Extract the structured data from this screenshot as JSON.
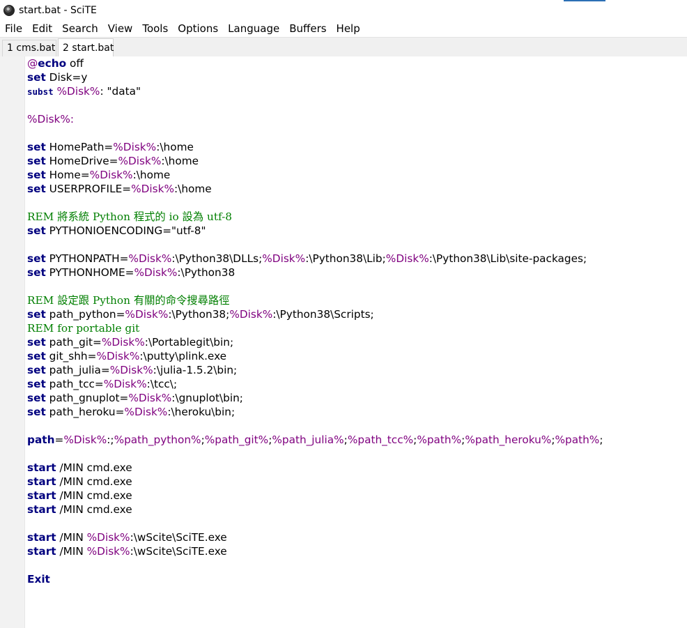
{
  "window": {
    "title": "start.bat - SciTE",
    "icon": "scite-app-icon"
  },
  "menu": [
    "File",
    "Edit",
    "Search",
    "View",
    "Tools",
    "Options",
    "Language",
    "Buffers",
    "Help"
  ],
  "tabs": [
    {
      "label": "1 cms.bat",
      "active": false
    },
    {
      "label": "2 start.bat",
      "active": true
    }
  ],
  "colors": {
    "keyword": "#00007f",
    "variable": "#7f007f",
    "comment": "#007f00",
    "text": "#000000"
  },
  "code": [
    [
      {
        "t": "@",
        "c": "var"
      },
      {
        "t": "echo",
        "c": "kw"
      },
      {
        "t": " off",
        "c": "op"
      }
    ],
    [
      {
        "t": "set",
        "c": "kw"
      },
      {
        "t": " Disk=y",
        "c": "op"
      }
    ],
    [
      {
        "t": "subst",
        "c": "kw-sub"
      },
      {
        "t": " ",
        "c": "op"
      },
      {
        "t": "%Disk%",
        "c": "var"
      },
      {
        "t": ": \"data\"",
        "c": "op"
      }
    ],
    [],
    [
      {
        "t": "%Disk%:",
        "c": "var"
      }
    ],
    [],
    [
      {
        "t": "set",
        "c": "kw"
      },
      {
        "t": " HomePath=",
        "c": "op"
      },
      {
        "t": "%Disk%",
        "c": "var"
      },
      {
        "t": ":\\home",
        "c": "op"
      }
    ],
    [
      {
        "t": "set",
        "c": "kw"
      },
      {
        "t": " HomeDrive=",
        "c": "op"
      },
      {
        "t": "%Disk%",
        "c": "var"
      },
      {
        "t": ":\\home",
        "c": "op"
      }
    ],
    [
      {
        "t": "set",
        "c": "kw"
      },
      {
        "t": " Home=",
        "c": "op"
      },
      {
        "t": "%Disk%",
        "c": "var"
      },
      {
        "t": ":\\home",
        "c": "op"
      }
    ],
    [
      {
        "t": "set",
        "c": "kw"
      },
      {
        "t": " USERPROFILE=",
        "c": "op"
      },
      {
        "t": "%Disk%",
        "c": "var"
      },
      {
        "t": ":\\home",
        "c": "op"
      }
    ],
    [],
    [
      {
        "t": "REM 將系統 Python 程式的 io 設為 utf-8",
        "c": "rem"
      }
    ],
    [
      {
        "t": "set",
        "c": "kw"
      },
      {
        "t": " PYTHONIOENCODING=\"utf-8\"",
        "c": "op"
      }
    ],
    [],
    [
      {
        "t": "set",
        "c": "kw"
      },
      {
        "t": " PYTHONPATH=",
        "c": "op"
      },
      {
        "t": "%Disk%",
        "c": "var"
      },
      {
        "t": ":\\Python38\\DLLs;",
        "c": "op"
      },
      {
        "t": "%Disk%",
        "c": "var"
      },
      {
        "t": ":\\Python38\\Lib;",
        "c": "op"
      },
      {
        "t": "%Disk%",
        "c": "var"
      },
      {
        "t": ":\\Python38\\Lib\\site-packages;",
        "c": "op"
      }
    ],
    [
      {
        "t": "set",
        "c": "kw"
      },
      {
        "t": " PYTHONHOME=",
        "c": "op"
      },
      {
        "t": "%Disk%",
        "c": "var"
      },
      {
        "t": ":\\Python38",
        "c": "op"
      }
    ],
    [],
    [
      {
        "t": "REM 設定跟 Python 有關的命令搜尋路徑",
        "c": "rem"
      }
    ],
    [
      {
        "t": "set",
        "c": "kw"
      },
      {
        "t": " path_python=",
        "c": "op"
      },
      {
        "t": "%Disk%",
        "c": "var"
      },
      {
        "t": ":\\Python38;",
        "c": "op"
      },
      {
        "t": "%Disk%",
        "c": "var"
      },
      {
        "t": ":\\Python38\\Scripts;",
        "c": "op"
      }
    ],
    [
      {
        "t": "REM for portable git",
        "c": "rem"
      }
    ],
    [
      {
        "t": "set",
        "c": "kw"
      },
      {
        "t": " path_git=",
        "c": "op"
      },
      {
        "t": "%Disk%",
        "c": "var"
      },
      {
        "t": ":\\Portablegit\\bin;",
        "c": "op"
      }
    ],
    [
      {
        "t": "set",
        "c": "kw"
      },
      {
        "t": " git_shh=",
        "c": "op"
      },
      {
        "t": "%Disk%",
        "c": "var"
      },
      {
        "t": ":\\putty\\plink.exe",
        "c": "op"
      }
    ],
    [
      {
        "t": "set",
        "c": "kw"
      },
      {
        "t": " path_julia=",
        "c": "op"
      },
      {
        "t": "%Disk%",
        "c": "var"
      },
      {
        "t": ":\\julia-1.5.2\\bin;",
        "c": "op"
      }
    ],
    [
      {
        "t": "set",
        "c": "kw"
      },
      {
        "t": " path_tcc=",
        "c": "op"
      },
      {
        "t": "%Disk%",
        "c": "var"
      },
      {
        "t": ":\\tcc\\;",
        "c": "op"
      }
    ],
    [
      {
        "t": "set",
        "c": "kw"
      },
      {
        "t": " path_gnuplot=",
        "c": "op"
      },
      {
        "t": "%Disk%",
        "c": "var"
      },
      {
        "t": ":\\gnuplot\\bin;",
        "c": "op"
      }
    ],
    [
      {
        "t": "set",
        "c": "kw"
      },
      {
        "t": " path_heroku=",
        "c": "op"
      },
      {
        "t": "%Disk%",
        "c": "var"
      },
      {
        "t": ":\\heroku\\bin;",
        "c": "op"
      }
    ],
    [],
    [
      {
        "t": "path",
        "c": "kw"
      },
      {
        "t": "=",
        "c": "op"
      },
      {
        "t": "%Disk%",
        "c": "var"
      },
      {
        "t": ":;",
        "c": "op"
      },
      {
        "t": "%path_python%",
        "c": "var"
      },
      {
        "t": ";",
        "c": "op"
      },
      {
        "t": "%path_git%",
        "c": "var"
      },
      {
        "t": ";",
        "c": "op"
      },
      {
        "t": "%path_julia%",
        "c": "var"
      },
      {
        "t": ";",
        "c": "op"
      },
      {
        "t": "%path_tcc%",
        "c": "var"
      },
      {
        "t": ";",
        "c": "op"
      },
      {
        "t": "%path%",
        "c": "var"
      },
      {
        "t": ";",
        "c": "op"
      },
      {
        "t": "%path_heroku%",
        "c": "var"
      },
      {
        "t": ";",
        "c": "op"
      },
      {
        "t": "%path%",
        "c": "var"
      },
      {
        "t": ";",
        "c": "op"
      }
    ],
    [],
    [
      {
        "t": "start",
        "c": "kw"
      },
      {
        "t": " /MIN cmd.exe",
        "c": "op"
      }
    ],
    [
      {
        "t": "start",
        "c": "kw"
      },
      {
        "t": " /MIN cmd.exe",
        "c": "op"
      }
    ],
    [
      {
        "t": "start",
        "c": "kw"
      },
      {
        "t": " /MIN cmd.exe",
        "c": "op"
      }
    ],
    [
      {
        "t": "start",
        "c": "kw"
      },
      {
        "t": " /MIN cmd.exe",
        "c": "op"
      }
    ],
    [],
    [
      {
        "t": "start",
        "c": "kw"
      },
      {
        "t": " /MIN ",
        "c": "op"
      },
      {
        "t": "%Disk%",
        "c": "var"
      },
      {
        "t": ":\\wScite\\SciTE.exe",
        "c": "op"
      }
    ],
    [
      {
        "t": "start",
        "c": "kw"
      },
      {
        "t": " /MIN ",
        "c": "op"
      },
      {
        "t": "%Disk%",
        "c": "var"
      },
      {
        "t": ":\\wScite\\SciTE.exe",
        "c": "op"
      }
    ],
    [],
    [
      {
        "t": "Exit",
        "c": "kw"
      }
    ]
  ]
}
